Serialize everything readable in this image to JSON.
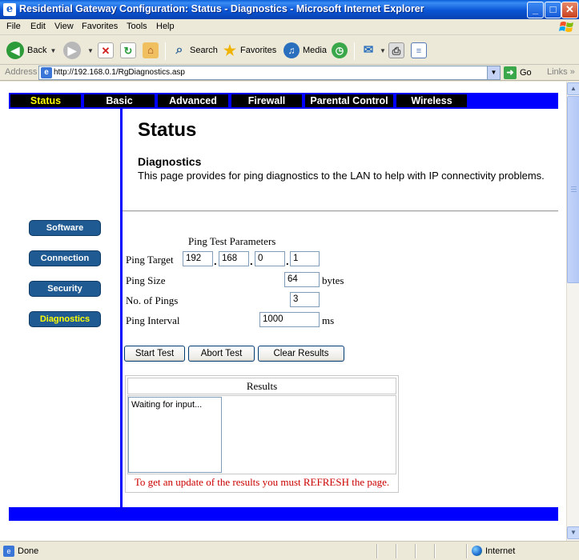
{
  "window": {
    "title": "Residential Gateway Configuration: Status - Diagnostics - Microsoft Internet Explorer",
    "minimize": "_",
    "maximize": "□",
    "close": "✕"
  },
  "menu": [
    "File",
    "Edit",
    "View",
    "Favorites",
    "Tools",
    "Help"
  ],
  "toolbar": {
    "back": "Back",
    "search": "Search",
    "favorites": "Favorites",
    "media": "Media"
  },
  "address": {
    "label": "Address",
    "url": "http://192.168.0.1/RgDiagnostics.asp",
    "go": "Go",
    "links": "Links"
  },
  "nav": {
    "tabs": [
      "Status",
      "Basic",
      "Advanced",
      "Firewall",
      "Parental Control",
      "Wireless"
    ],
    "active": "Status"
  },
  "sidebar": {
    "items": [
      "Software",
      "Connection",
      "Security",
      "Diagnostics"
    ],
    "active": "Diagnostics"
  },
  "page": {
    "title": "Status",
    "section_title": "Diagnostics",
    "section_desc": "This page provides for ping diagnostics to the LAN to help with IP connectivity problems."
  },
  "ping": {
    "header": "Ping Test Parameters",
    "target_label": "Ping Target",
    "target_octets": [
      "192",
      "168",
      "0",
      "1"
    ],
    "size_label": "Ping Size",
    "size_value": "64",
    "size_unit": "bytes",
    "count_label": "No. of Pings",
    "count_value": "3",
    "interval_label": "Ping Interval",
    "interval_value": "1000",
    "interval_unit": "ms"
  },
  "buttons": {
    "start": "Start Test",
    "abort": "Abort Test",
    "clear": "Clear Results"
  },
  "results": {
    "header": "Results",
    "content": "Waiting for input...",
    "note": "To get an update of the results you must REFRESH the page."
  },
  "status": {
    "text": "Done",
    "zone": "Internet"
  },
  "colors": {
    "nav_background": "#0000ff",
    "active_text": "#ffff00",
    "sidebar_button": "#1f5a92",
    "note_text": "#cc0000"
  }
}
